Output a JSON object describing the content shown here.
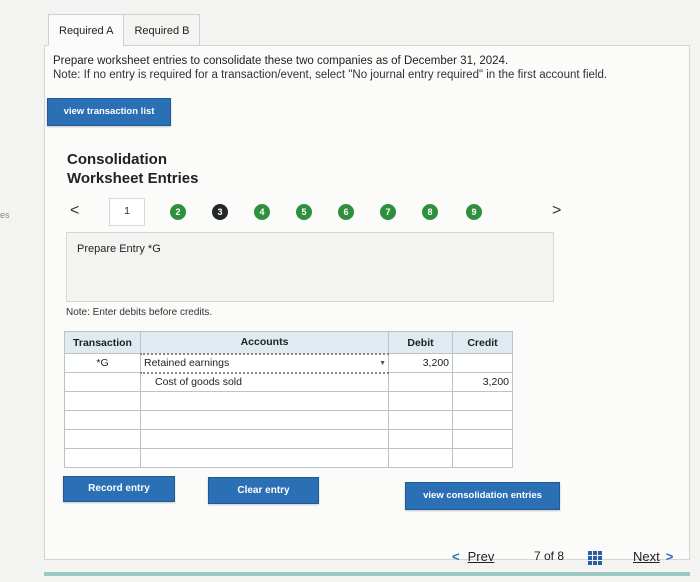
{
  "edge_text": "es",
  "tabs": [
    {
      "label": "Required A"
    },
    {
      "label": "Required B"
    }
  ],
  "instructions": {
    "line1": "Prepare worksheet entries to consolidate these two companies as of December 31, 2024.",
    "line2": "Note: If no entry is required for a transaction/event, select \"No journal entry required\" in the first account field."
  },
  "view_transaction_list": "view transaction list",
  "worksheet_title": {
    "line1": "Consolidation",
    "line2": "Worksheet Entries"
  },
  "stepper": {
    "left_arrow": "<",
    "right_arrow": ">",
    "current": "1",
    "steps": [
      "2",
      "3",
      "4",
      "5",
      "6",
      "7",
      "8",
      "9"
    ]
  },
  "prepare_text": "Prepare Entry *G",
  "enter_note": "Note: Enter debits before credits.",
  "table": {
    "headers": {
      "transaction": "Transaction",
      "accounts": "Accounts",
      "debit": "Debit",
      "credit": "Credit"
    },
    "rows": [
      {
        "transaction": "*G",
        "account": "Retained earnings",
        "debit": "3,200",
        "credit": ""
      },
      {
        "transaction": "",
        "account": "Cost of goods sold",
        "debit": "",
        "credit": "3,200"
      },
      {
        "transaction": "",
        "account": "",
        "debit": "",
        "credit": ""
      },
      {
        "transaction": "",
        "account": "",
        "debit": "",
        "credit": ""
      },
      {
        "transaction": "",
        "account": "",
        "debit": "",
        "credit": ""
      },
      {
        "transaction": "",
        "account": "",
        "debit": "",
        "credit": ""
      }
    ]
  },
  "buttons": {
    "record": "Record entry",
    "clear": "Clear entry",
    "view_consolidation": "view consolidation entries"
  },
  "footer": {
    "prev_chevron": "<",
    "prev": "Prev",
    "position": "7 of 8",
    "next": "Next",
    "next_chevron": ">"
  },
  "colors": {
    "accent": "#2b6fb4",
    "step_done": "#2e8f3e",
    "step_current": "#22272b"
  }
}
